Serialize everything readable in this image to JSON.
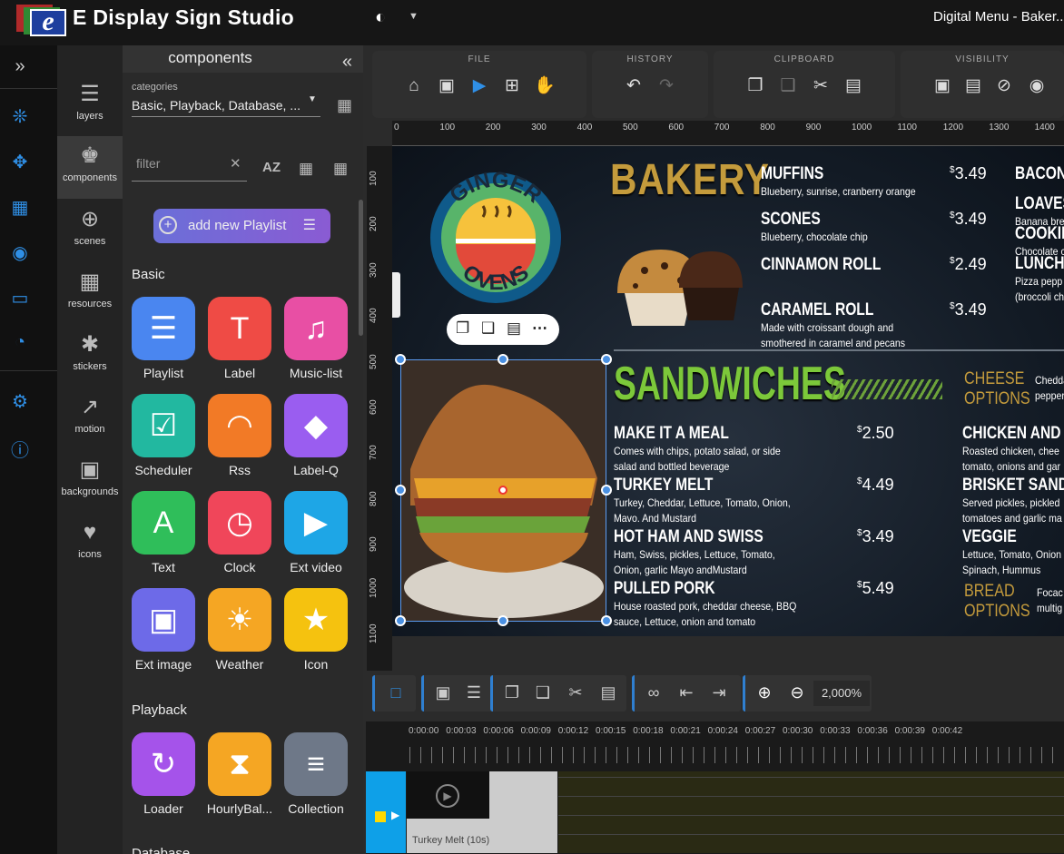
{
  "app": {
    "title": "E Display Sign Studio",
    "document_title": "Digital Menu - Baker..."
  },
  "panel": {
    "title": "components",
    "categories_label": "categories",
    "categories_value": "Basic, Playback, Database, ...",
    "filter_placeholder": "filter",
    "add_playlist_label": "add new Playlist",
    "sections": [
      "Basic",
      "Playback",
      "Database"
    ],
    "basic": [
      {
        "label": "Playlist",
        "color": "#4a86f0"
      },
      {
        "label": "Label",
        "color": "#ef4b45"
      },
      {
        "label": "Music-list",
        "color": "#e84fa4"
      },
      {
        "label": "Scheduler",
        "color": "#22b8a0"
      },
      {
        "label": "Rss",
        "color": "#f27a26"
      },
      {
        "label": "Label-Q",
        "color": "#9a5df0"
      },
      {
        "label": "Text",
        "color": "#2fbe5a"
      },
      {
        "label": "Clock",
        "color": "#f0465a"
      },
      {
        "label": "Ext video",
        "color": "#1ea6e6"
      },
      {
        "label": "Ext image",
        "color": "#6d6ae8"
      },
      {
        "label": "Weather",
        "color": "#f5a623"
      },
      {
        "label": "Icon",
        "color": "#f5c20f"
      }
    ],
    "playback": [
      {
        "label": "Loader",
        "color": "#a553ea"
      },
      {
        "label": "HourlyBal...",
        "color": "#f5a623"
      },
      {
        "label": "Collection",
        "color": "#6e7888"
      }
    ]
  },
  "rail": [
    "layers",
    "components",
    "scenes",
    "resources",
    "stickers",
    "motion",
    "backgrounds",
    "icons"
  ],
  "toolbar": {
    "groups": [
      "FILE",
      "HISTORY",
      "CLIPBOARD",
      "VISIBILITY"
    ]
  },
  "ruler": {
    "h": [
      "0",
      "100",
      "200",
      "300",
      "400",
      "500",
      "600",
      "700",
      "800",
      "900",
      "1000",
      "1100",
      "1200",
      "1300",
      "1400"
    ],
    "v": [
      "100",
      "200",
      "300",
      "400",
      "500",
      "600",
      "700",
      "800",
      "900",
      "1000",
      "1100"
    ]
  },
  "menu": {
    "bakery_title": "BAKERY",
    "sandwiches_title": "SANDWICHES",
    "logo_top": "GINGER",
    "logo_bottom": "OVENS",
    "bakery_items": [
      {
        "name": "MUFFINS",
        "desc": "Blueberry, sunrise, cranberry orange",
        "price": "3.49"
      },
      {
        "name": "SCONES",
        "desc": "Blueberry, chocolate chip",
        "price": "3.49"
      },
      {
        "name": "CINNAMON ROLL",
        "desc": "",
        "price": "2.49"
      },
      {
        "name": "CARAMEL ROLL",
        "desc": "Made with croissant dough and",
        "desc2": "smothered in caramel and pecans",
        "price": "3.49"
      }
    ],
    "right_items": [
      {
        "name": "BACON",
        "desc": ""
      },
      {
        "name": "LOAVES",
        "desc": "Banana bre"
      },
      {
        "name": "COOKIE",
        "desc": "Chocolate c"
      },
      {
        "name": "LUNCH",
        "desc": "Pizza pepp",
        "desc2": "(broccoli ch"
      }
    ],
    "sandwich_items": [
      {
        "name": "MAKE IT A MEAL",
        "desc": "Comes with chips, potato salad, or side",
        "desc2": "salad and bottled beverage",
        "price": "2.50"
      },
      {
        "name": "TURKEY MELT",
        "desc": "Turkey, Cheddar, Lettuce, Tomato, Onion,",
        "desc2": "Mavo. And Mustard",
        "price": "4.49"
      },
      {
        "name": "HOT HAM AND SWISS",
        "desc": "Ham, Swiss, pickles, Lettuce, Tomato,",
        "desc2": "Onion, garlic Mayo andMustard",
        "price": "3.49"
      },
      {
        "name": "PULLED PORK",
        "desc": "House roasted pork, cheddar cheese, BBQ",
        "desc2": "sauce, Lettuce, onion and tomato",
        "price": "5.49"
      }
    ],
    "cheese_label": "CHEESE OPTIONS",
    "cheese_text": "Chedda",
    "cheese_text2": "pepper",
    "right_sandwiches": [
      {
        "name": "CHICKEN AND E",
        "desc": "Roasted chicken, chee",
        "desc2": "tomato, onions and gar"
      },
      {
        "name": "BRISKET SAND",
        "desc": "Served pickles, pickled",
        "desc2": "tomatoes and garlic ma"
      },
      {
        "name": "VEGGIE",
        "desc": "Lettuce, Tomato, Onion",
        "desc2": "Spinach, Hummus"
      }
    ],
    "bread_label": "BREAD OPTIONS",
    "bread_text": "Focac",
    "bread_text2": "multig"
  },
  "zoom": "2,000%",
  "timeline": {
    "marks": [
      "0:00:00",
      "0:00:03",
      "0:00:06",
      "0:00:09",
      "0:00:12",
      "0:00:15",
      "0:00:18",
      "0:00:21",
      "0:00:24",
      "0:00:27",
      "0:00:30",
      "0:00:33",
      "0:00:36",
      "0:00:39",
      "0:00:42"
    ],
    "clip_label": "Turkey Melt (10s)"
  }
}
